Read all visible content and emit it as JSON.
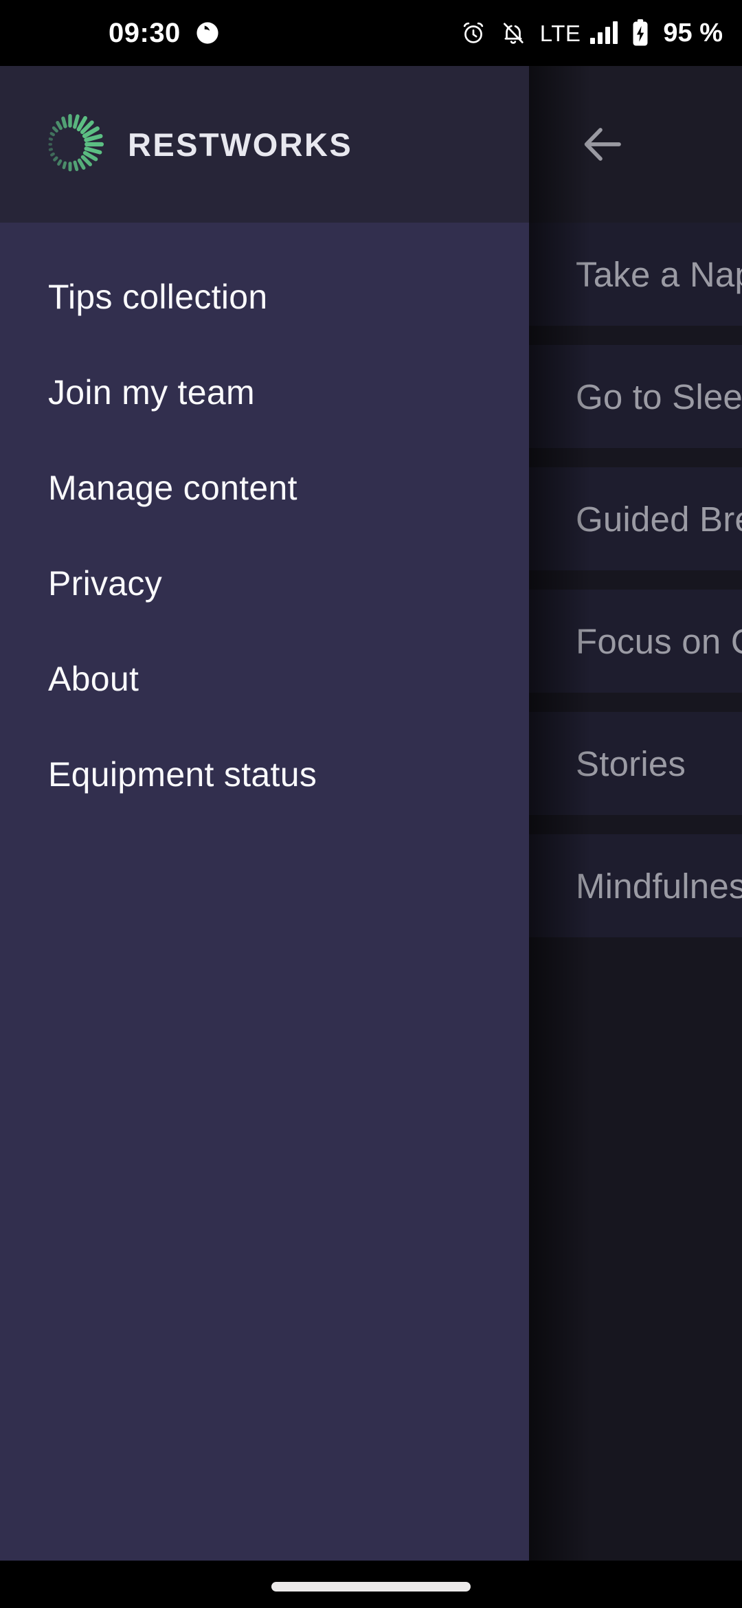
{
  "status_bar": {
    "time": "09:30",
    "icons_left": [
      "app-badge-icon"
    ],
    "icons_right": [
      "alarm-icon",
      "notifications-muted-icon",
      "signal-bars-icon",
      "battery-charging-icon"
    ],
    "network_type": "LTE",
    "battery_percent": "95 %"
  },
  "drawer": {
    "brand_name": "RESTWORKS",
    "logo_icon": "radial-burst-logo-icon",
    "accent_color": "#5cbf83",
    "header_bg": "#272538",
    "body_bg": "#322f4e",
    "items": [
      {
        "label": "Tips collection"
      },
      {
        "label": "Join my team"
      },
      {
        "label": "Manage content"
      },
      {
        "label": "Privacy"
      },
      {
        "label": "About"
      },
      {
        "label": "Equipment status"
      }
    ]
  },
  "background_screen": {
    "back_icon": "arrow-left-icon",
    "appbar_bg": "#1c1b26",
    "page_bg": "#17161f",
    "card_bg": "#1e1d2e",
    "cards": [
      {
        "label": "Take a Nap"
      },
      {
        "label": "Go to Sleep"
      },
      {
        "label": "Guided Breathing"
      },
      {
        "label": "Focus on Calm"
      },
      {
        "label": "Stories"
      },
      {
        "label": "Mindfulness"
      }
    ]
  },
  "gesture_bar": {
    "handle": "home-gesture-pill"
  }
}
